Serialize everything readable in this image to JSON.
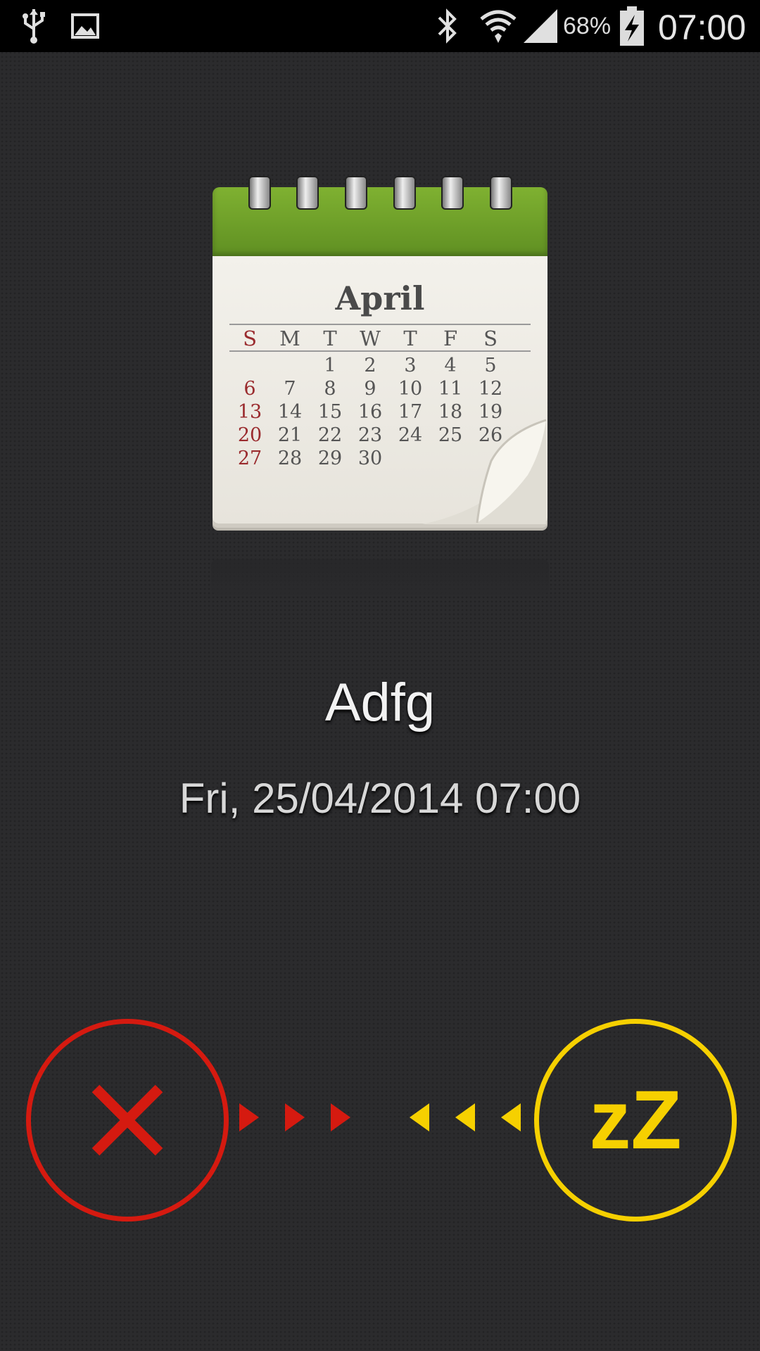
{
  "status_bar": {
    "icons": [
      "usb-icon",
      "image-icon",
      "bluetooth-icon",
      "wifi-icon",
      "signal-icon",
      "battery-charging-icon"
    ],
    "battery_percent": "68%",
    "time": "07:00"
  },
  "calendar": {
    "month": "April",
    "weekdays": [
      "S",
      "M",
      "T",
      "W",
      "T",
      "F",
      "S"
    ],
    "weeks": [
      [
        "",
        "",
        "1",
        "2",
        "3",
        "4",
        "5"
      ],
      [
        "6",
        "7",
        "8",
        "9",
        "10",
        "11",
        "12"
      ],
      [
        "13",
        "14",
        "15",
        "16",
        "17",
        "18",
        "19"
      ],
      [
        "20",
        "21",
        "22",
        "23",
        "24",
        "25",
        "26"
      ],
      [
        "27",
        "28",
        "29",
        "30",
        "",
        "",
        ""
      ]
    ]
  },
  "alarm": {
    "label": "Adfg",
    "datetime": "Fri, 25/04/2014 07:00"
  },
  "actions": {
    "dismiss_icon": "close-icon",
    "snooze_label": "zZ"
  },
  "colors": {
    "dismiss": "#d51a10",
    "snooze": "#f6d000",
    "calendar_header": "#6f9f29",
    "sunday": "#9a2b2e"
  }
}
